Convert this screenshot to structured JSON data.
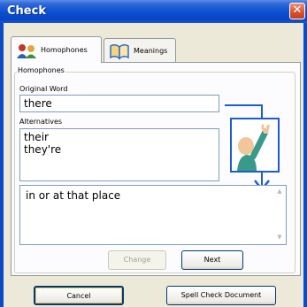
{
  "window": {
    "title": "Check",
    "close_glyph": "✕"
  },
  "tabs": [
    {
      "label": "Homophones",
      "icon": "people-icon",
      "active": true
    },
    {
      "label": "Meanings",
      "icon": "book-icon",
      "active": false
    }
  ],
  "homophones": {
    "group_label": "Homophones",
    "original_word_label": "Original Word",
    "original_word_value": "there",
    "alternatives_label": "Alternatives",
    "alternatives": [
      "their",
      "they're"
    ],
    "definition": "in or at that place"
  },
  "buttons": {
    "change": "Change",
    "next": "Next",
    "cancel": "Cancel",
    "spell_check": "Spell Check Document"
  },
  "colors": {
    "titlebar": "#0a4fd0",
    "accent": "#1b5bd6",
    "panel_bg": "#fcfcfe",
    "dialog_bg": "#ece9d8"
  }
}
